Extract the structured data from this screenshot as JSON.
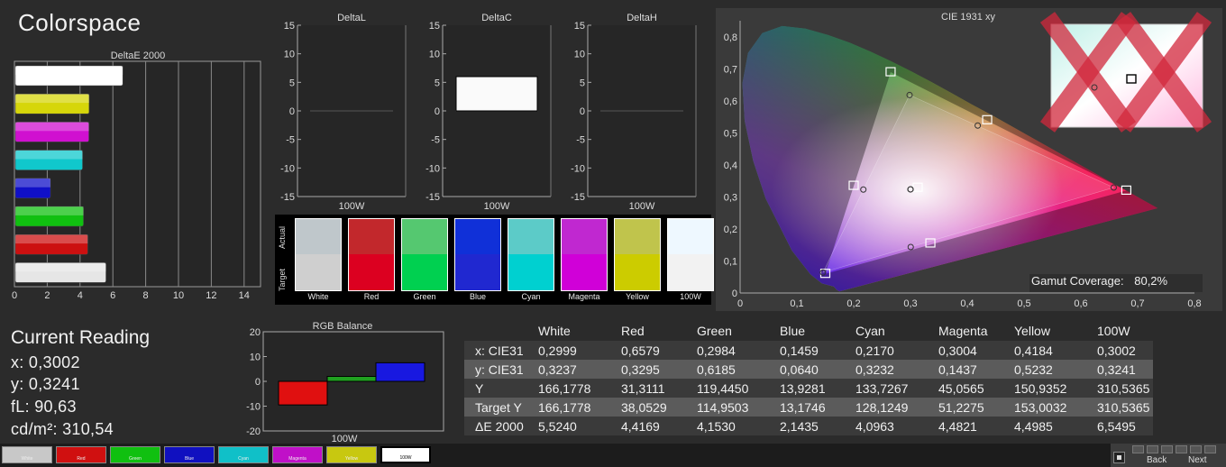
{
  "app": {
    "title": "Colorspace"
  },
  "deltae_chart": {
    "title": "DeltaE 2000",
    "x_ticks": [
      "0",
      "2",
      "4",
      "6",
      "8",
      "10",
      "12",
      "14"
    ],
    "bars": [
      {
        "name": "100W",
        "value": 6.5495,
        "color": "#ffffff"
      },
      {
        "name": "Yellow",
        "value": 4.4985,
        "color": "#d6d60a"
      },
      {
        "name": "Magenta",
        "value": 4.4821,
        "color": "#d010d0"
      },
      {
        "name": "Cyan",
        "value": 4.0963,
        "color": "#10c8cc"
      },
      {
        "name": "Blue",
        "value": 2.1435,
        "color": "#1010c8"
      },
      {
        "name": "Green",
        "value": 4.153,
        "color": "#10c010"
      },
      {
        "name": "Red",
        "value": 4.4169,
        "color": "#cc1010"
      },
      {
        "name": "White",
        "value": 5.524,
        "color": "#e6e6e6"
      }
    ]
  },
  "delta_panels": [
    {
      "title": "DeltaL",
      "category": "100W",
      "value": 0.0
    },
    {
      "title": "DeltaC",
      "category": "100W",
      "value": 6.0
    },
    {
      "title": "DeltaH",
      "category": "100W",
      "value": 0.0
    }
  ],
  "delta_y_ticks": [
    "15",
    "10",
    "5",
    "0",
    "-5",
    "-10",
    "-15"
  ],
  "swatch_panel": {
    "actual_label": "Actual",
    "target_label": "Target",
    "items": [
      {
        "name": "White",
        "actual": "#bfc7cb",
        "target": "#cfcfcf"
      },
      {
        "name": "Red",
        "actual": "#c2282c",
        "target": "#dc0020"
      },
      {
        "name": "Green",
        "actual": "#55c870",
        "target": "#00d050"
      },
      {
        "name": "Blue",
        "actual": "#1030d8",
        "target": "#2028d0"
      },
      {
        "name": "Cyan",
        "actual": "#5ccbc8",
        "target": "#00d0d0"
      },
      {
        "name": "Magenta",
        "actual": "#c028d0",
        "target": "#d000d8"
      },
      {
        "name": "Yellow",
        "actual": "#c0c44c",
        "target": "#cccc00"
      },
      {
        "name": "100W",
        "actual": "#eef8ff",
        "target": "#f2f2f2"
      }
    ]
  },
  "cie": {
    "title": "CIE 1931 xy",
    "x_ticks": [
      "0",
      "0,1",
      "0,2",
      "0,3",
      "0,4",
      "0,5",
      "0,6",
      "0,7",
      "0,8"
    ],
    "y_ticks": [
      "0,8",
      "0,7",
      "0,6",
      "0,5",
      "0,4",
      "0,3",
      "0,2",
      "0,1",
      "0"
    ],
    "gamut_label": "Gamut Coverage:",
    "gamut_value": "80,2%"
  },
  "current_reading": {
    "title": "Current Reading",
    "x": "x: 0,3002",
    "y": "y: 0,3241",
    "fl": "fL: 90,63",
    "cdm2": "cd/m²: 310,54"
  },
  "rgb_balance": {
    "title": "RGB Balance",
    "y_ticks": [
      "20",
      "10",
      "0",
      "-10",
      "-20"
    ],
    "category": "100W",
    "bars": [
      {
        "name": "Red",
        "value": -9.5,
        "color": "#e01010"
      },
      {
        "name": "Green",
        "value": 2.0,
        "color": "#20a020"
      },
      {
        "name": "Blue",
        "value": 7.5,
        "color": "#1818e0"
      }
    ]
  },
  "table": {
    "columns": [
      "",
      "White",
      "Red",
      "Green",
      "Blue",
      "Cyan",
      "Magenta",
      "Yellow",
      "100W"
    ],
    "rows": [
      [
        "x: CIE31",
        "0,2999",
        "0,6579",
        "0,2984",
        "0,1459",
        "0,2170",
        "0,3004",
        "0,4184",
        "0,3002"
      ],
      [
        "y: CIE31",
        "0,3237",
        "0,3295",
        "0,6185",
        "0,0640",
        "0,3232",
        "0,1437",
        "0,5232",
        "0,3241"
      ],
      [
        "Y",
        "166,1778",
        "31,3111",
        "119,4450",
        "13,9281",
        "133,7267",
        "45,0565",
        "150,9352",
        "310,5365"
      ],
      [
        "Target Y",
        "166,1778",
        "38,0529",
        "114,9503",
        "13,1746",
        "128,1249",
        "51,2275",
        "153,0032",
        "310,5365"
      ],
      [
        "ΔE 2000",
        "5,5240",
        "4,4169",
        "4,1530",
        "2,1435",
        "4,0963",
        "4,4821",
        "4,4985",
        "6,5495"
      ]
    ]
  },
  "bottom_swatches": [
    {
      "label": "White",
      "color": "#c8c8c8"
    },
    {
      "label": "Red",
      "color": "#d01010"
    },
    {
      "label": "Green",
      "color": "#10c010"
    },
    {
      "label": "Blue",
      "color": "#1010c0"
    },
    {
      "label": "Cyan",
      "color": "#10c0c8"
    },
    {
      "label": "Magenta",
      "color": "#c010c8"
    },
    {
      "label": "Yellow",
      "color": "#c8c810"
    },
    {
      "label": "100W",
      "color": "#ffffff"
    }
  ],
  "nav": {
    "back": "Back",
    "next": "Next"
  },
  "chart_data": [
    {
      "type": "bar",
      "title": "DeltaE 2000",
      "categories": [
        "100W",
        "Yellow",
        "Magenta",
        "Cyan",
        "Blue",
        "Green",
        "Red",
        "White"
      ],
      "values": [
        6.5495,
        4.4985,
        4.4821,
        4.0963,
        2.1435,
        4.153,
        4.4169,
        5.524
      ],
      "xlim": [
        0,
        15
      ],
      "orientation": "horizontal"
    },
    {
      "type": "bar",
      "title": "DeltaL",
      "categories": [
        "100W"
      ],
      "values": [
        0.0
      ],
      "ylim": [
        -15,
        15
      ]
    },
    {
      "type": "bar",
      "title": "DeltaC",
      "categories": [
        "100W"
      ],
      "values": [
        6.0
      ],
      "ylim": [
        -15,
        15
      ]
    },
    {
      "type": "bar",
      "title": "DeltaH",
      "categories": [
        "100W"
      ],
      "values": [
        0.0
      ],
      "ylim": [
        -15,
        15
      ]
    },
    {
      "type": "bar",
      "title": "RGB Balance",
      "categories": [
        "100W"
      ],
      "series": [
        {
          "values": [
            -9.5
          ]
        },
        {
          "values": [
            2.0
          ]
        },
        {
          "values": [
            7.5
          ]
        }
      ],
      "ylim": [
        -20,
        20
      ]
    },
    {
      "type": "scatter",
      "title": "CIE 1931 xy",
      "xlim": [
        0,
        0.8
      ],
      "ylim": [
        0,
        0.8
      ],
      "series": [
        {
          "values": [
            [
              0.2999,
              0.3237
            ],
            [
              0.6579,
              0.3295
            ],
            [
              0.2984,
              0.6185
            ],
            [
              0.1459,
              0.064
            ],
            [
              0.217,
              0.3232
            ],
            [
              0.3004,
              0.1437
            ],
            [
              0.4184,
              0.5232
            ],
            [
              0.3002,
              0.3241
            ]
          ]
        },
        {
          "values": [
            [
              0.3127,
              0.329
            ],
            [
              0.68,
              0.32
            ],
            [
              0.265,
              0.69
            ],
            [
              0.15,
              0.06
            ],
            [
              0.2,
              0.335
            ],
            [
              0.335,
              0.155
            ],
            [
              0.435,
              0.54
            ]
          ]
        }
      ]
    }
  ]
}
